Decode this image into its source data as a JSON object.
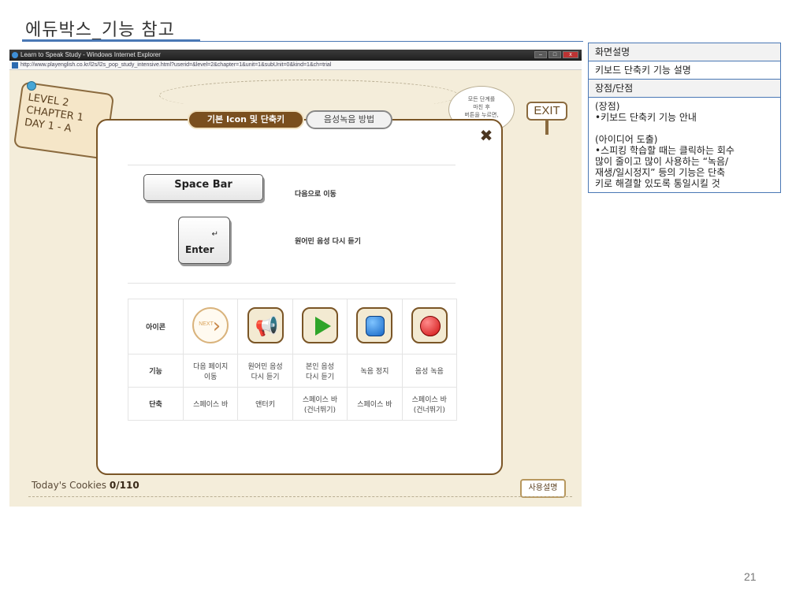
{
  "slide": {
    "title": "에듀박스_기능 참고",
    "page_number": "21"
  },
  "browser": {
    "window_title": "Learn to Speak Study - Windows Internet Explorer",
    "url": "http://www.playenglish.co.kr/l2s/l2s_pop_study_intensive.html?userid=&level=2&chapter=1&unit=1&subUnit=0&kind=1&ch=trial"
  },
  "game": {
    "level_line1": "LEVEL 2",
    "level_line2": "CHAPTER 1",
    "level_line3": "DAY 1 - A",
    "speech_line1": "모든 단계를",
    "speech_line2": "마친 후",
    "speech_line3": "버튼을 누르면,",
    "exit_label": "EXIT",
    "cookies_label": "Today's Cookies",
    "cookies_value": "0/110",
    "help_label": "사용설명"
  },
  "modal": {
    "tab_active": "기본 Icon 및 단축키",
    "tab_inactive": "음성녹음 방법",
    "close_symbol": "✖",
    "space_key_label": "Space Bar",
    "space_desc": "다음으로 이동",
    "enter_key_label": "Enter",
    "enter_symbol": "↵",
    "enter_desc": "원어민 음성 다시 듣기",
    "table": {
      "row_icon_head": "아이콘",
      "row_func_head": "기능",
      "row_key_head": "단축",
      "next_icon_text": "NEXT",
      "functions": [
        {
          "line1": "다음 페이지",
          "line2": "이동"
        },
        {
          "line1": "원어민 음성",
          "line2": "다시 듣기"
        },
        {
          "line1": "본인 음성",
          "line2": "다시 듣기"
        },
        {
          "line1": "녹음 정지",
          "line2": ""
        },
        {
          "line1": "음성 녹음",
          "line2": ""
        }
      ],
      "shortcuts": [
        {
          "line1": "스페이스 바",
          "line2": ""
        },
        {
          "line1": "앤터키",
          "line2": ""
        },
        {
          "line1": "스페이스 바",
          "line2": "(건너뛰기)"
        },
        {
          "line1": "스페이스 바",
          "line2": ""
        },
        {
          "line1": "스페이스 바",
          "line2": "(건너뛰기)"
        }
      ]
    }
  },
  "side_panel": {
    "row1": "화면설명",
    "row2": "키보드 단축키 기능 설명",
    "row3": "장점/단점",
    "body": [
      "(장점)",
      "•키보드 단축키 기능 안내",
      "",
      "(아이디어 도출)",
      "•스피킹 학습할 때는 클릭하는 회수",
      "많이 줄이고 많이 사용하는 “녹음/",
      "재생/일시정지” 등의 기능은 단축",
      "키로 해결할 있도록 통일시킬 것"
    ]
  },
  "colors": {
    "accent_blue": "#4a78b5",
    "modal_border": "#7a5526",
    "tab_active_bg": "#7a4f1e",
    "game_bg": "#f4edda"
  }
}
